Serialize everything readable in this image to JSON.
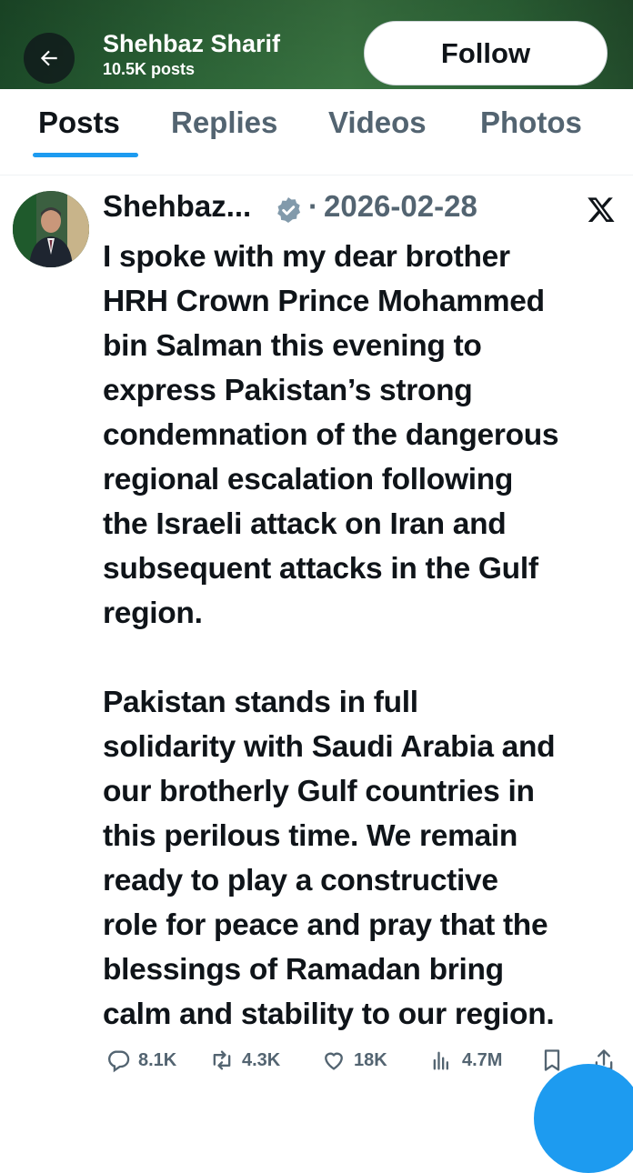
{
  "header": {
    "name": "Shehbaz Sharif",
    "posts_count": "10.5K posts",
    "follow_label": "Follow",
    "banner_color": "#2f6a3a"
  },
  "tabs": [
    {
      "label": "Posts",
      "active": true
    },
    {
      "label": "Replies",
      "active": false
    },
    {
      "label": "Videos",
      "active": false
    },
    {
      "label": "Photos",
      "active": false
    }
  ],
  "tweet": {
    "author": "Shehbaz...",
    "separator": "·",
    "date": "2026-02-28",
    "lines": [
      "I spoke with my dear brother",
      "HRH Crown Prince Mohammed",
      "bin Salman this evening to",
      "express Pakistan’s strong",
      "condemnation of the dangerous",
      "regional escalation following",
      "the Israeli attack on Iran and",
      "subsequent attacks in the Gulf",
      "region.",
      "",
      "Pakistan stands in full",
      "solidarity with Saudi Arabia and",
      "our brotherly Gulf countries in",
      "this perilous time. We remain",
      "ready to play a constructive",
      "role for peace and pray that the",
      "blessings of Ramadan bring",
      "calm and stability to our region."
    ]
  },
  "actions": {
    "replies": "8.1K",
    "reposts": "4.3K",
    "likes": "18K",
    "views": "4.7M"
  },
  "colors": {
    "accent": "#1d9bf0",
    "text_primary": "#0f1419",
    "text_secondary": "#536471"
  }
}
